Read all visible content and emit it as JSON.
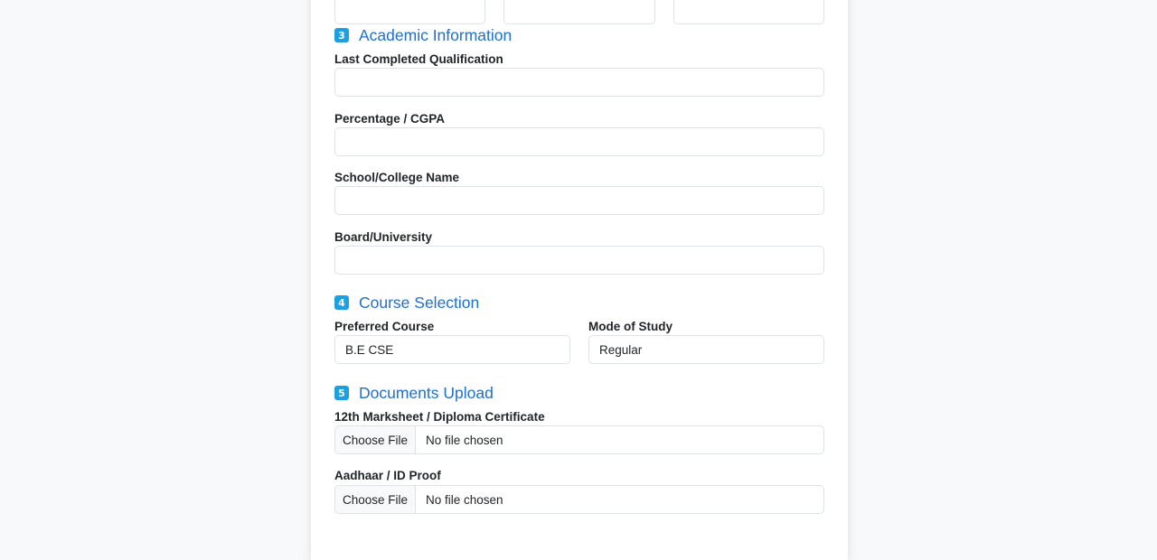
{
  "sections": {
    "academic": {
      "number": "3",
      "title": "Academic Information",
      "fields": [
        {
          "label": "Last Completed Qualification",
          "value": ""
        },
        {
          "label": "Percentage / CGPA",
          "value": ""
        },
        {
          "label": "School/College Name",
          "value": ""
        },
        {
          "label": "Board/University",
          "value": ""
        }
      ]
    },
    "course": {
      "number": "4",
      "title": "Course Selection",
      "preferred_course": {
        "label": "Preferred Course",
        "value": "B.E CSE"
      },
      "mode_of_study": {
        "label": "Mode of Study",
        "value": "Regular"
      }
    },
    "documents": {
      "number": "5",
      "title": "Documents Upload",
      "uploads": [
        {
          "label": "12th Marksheet / Diploma Certificate",
          "button": "Choose File",
          "status": "No file chosen"
        },
        {
          "label": "Aadhaar / ID Proof",
          "button": "Choose File",
          "status": "No file chosen"
        }
      ]
    }
  },
  "colors": {
    "page_background": "#f8f9fa",
    "section_title": "#1f6fd0",
    "number_badge": "#1ba0e2"
  },
  "icons": {
    "section_number_badge": "keycap-digit-icon"
  }
}
